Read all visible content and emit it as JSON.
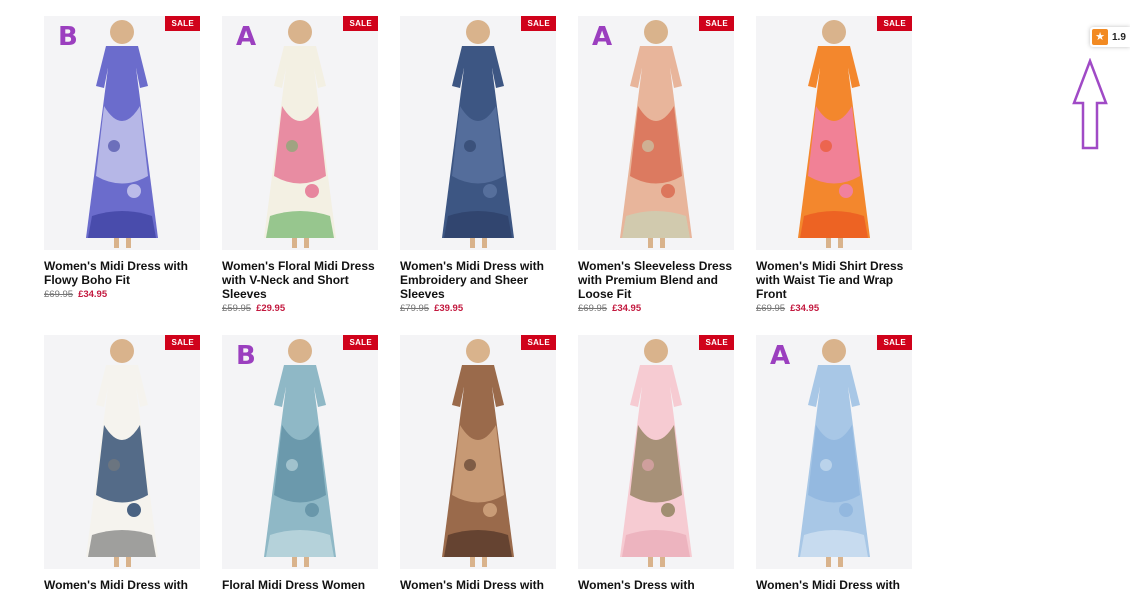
{
  "rating": {
    "icon": "star-icon",
    "value": "1.9"
  },
  "sale_label": "SALE",
  "products": [
    {
      "variant": "B",
      "title": "Women's Midi Dress with Flowy Boho Fit",
      "old_price": "£69.95",
      "new_price": "£34.95",
      "colors": [
        "#6b6ccc",
        "#cfd0f0",
        "#3b3f9e"
      ]
    },
    {
      "variant": "A",
      "title": "Women's Floral Midi Dress with V-Neck and Short Sleeves",
      "old_price": "£59.95",
      "new_price": "£29.95",
      "colors": [
        "#f3f0e3",
        "#e46b8c",
        "#6fb36a"
      ]
    },
    {
      "variant": "",
      "title": "Women's Midi Dress with Embroidery and Sheer Sleeves",
      "old_price": "£79.95",
      "new_price": "£39.95",
      "colors": [
        "#3d5683",
        "#5c75a3",
        "#2c3f66"
      ]
    },
    {
      "variant": "A",
      "title": "Women's Sleeveless Dress with Premium Blend and Loose Fit",
      "old_price": "£69.95",
      "new_price": "£34.95",
      "colors": [
        "#e8b59b",
        "#d8674c",
        "#c7d3b6"
      ]
    },
    {
      "variant": "",
      "title": "Women's Midi Shirt Dress with Waist Tie and Wrap Front",
      "old_price": "£69.95",
      "new_price": "£34.95",
      "colors": [
        "#f3872d",
        "#f07fb9",
        "#e95420"
      ]
    },
    {
      "variant": "",
      "title": "Women's Midi Dress with",
      "old_price": "",
      "new_price": "",
      "colors": [
        "#f5f3ee",
        "#1e3d66",
        "#7b7b7b"
      ]
    },
    {
      "variant": "B",
      "title": "Floral Midi Dress Women",
      "old_price": "",
      "new_price": "",
      "colors": [
        "#8fb8c6",
        "#5f8fa3",
        "#c5dde2"
      ]
    },
    {
      "variant": "",
      "title": "Women's Midi Dress with",
      "old_price": "",
      "new_price": "",
      "colors": [
        "#9a6a4b",
        "#d5a982",
        "#4e3327"
      ]
    },
    {
      "variant": "",
      "title": "Women's Dress with",
      "old_price": "",
      "new_price": "",
      "colors": [
        "#f6cbd2",
        "#8c7e5a",
        "#eaa9b6"
      ]
    },
    {
      "variant": "A",
      "title": "Women's Midi Dress with",
      "old_price": "",
      "new_price": "",
      "colors": [
        "#a8c7e6",
        "#8db4dd",
        "#d4e4f2"
      ]
    }
  ]
}
